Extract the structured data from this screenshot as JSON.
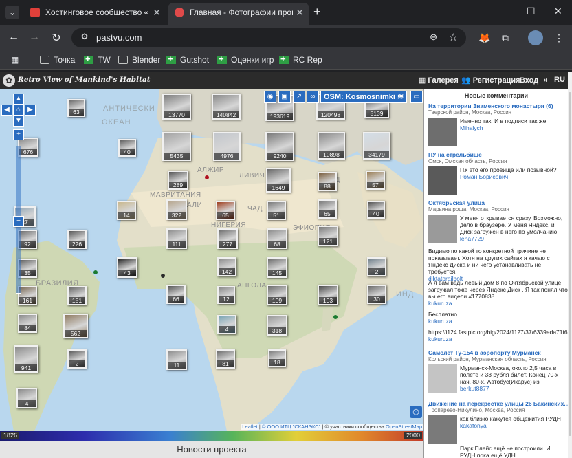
{
  "browser": {
    "tabs": [
      {
        "title": "Хостинговое сообщество «Tim",
        "favicon_color": "#e0403a"
      },
      {
        "title": "Главная - Фотографии прошло",
        "favicon_color": "#e04a4a"
      }
    ],
    "url": "pastvu.com",
    "bookmarks": [
      {
        "label": "Точка",
        "icon": "folder"
      },
      {
        "label": "TW",
        "icon": "green-plus"
      },
      {
        "label": "Blender",
        "icon": "folder"
      },
      {
        "label": "Gutshot",
        "icon": "green-plus"
      },
      {
        "label": "Оценки игр",
        "icon": "green-plus"
      },
      {
        "label": "RC Rep",
        "icon": "green-plus"
      }
    ]
  },
  "site": {
    "title": "Retro View of Mankind's Habitat",
    "nav": {
      "gallery": "Галерея",
      "register": "Регистрация",
      "login": "Вход",
      "lang": "RU"
    }
  },
  "map": {
    "layer_button": "OSM: Kosmosnimki",
    "labels": [
      {
        "id": "ocean",
        "text": "ОКЕАН"
      },
      {
        "id": "atl",
        "text": "АНТИЧЕСКИ"
      },
      {
        "id": "algeria",
        "text": "АЛЖИР"
      },
      {
        "id": "libya",
        "text": "ЛИВИЯ"
      },
      {
        "id": "saudi",
        "text": "САУД"
      },
      {
        "id": "mauritania",
        "text": "МАВРИТАНИЯ"
      },
      {
        "id": "mali",
        "text": "АЛИ"
      },
      {
        "id": "chad",
        "text": "ЧАД"
      },
      {
        "id": "nigeria",
        "text": "НИГЕРИЯ"
      },
      {
        "id": "ethiopia",
        "text": "ЭФИОПИЯ"
      },
      {
        "id": "angola",
        "text": "АНГОЛА"
      },
      {
        "id": "brazil",
        "text": "БРАЗИЛИЯ"
      },
      {
        "id": "indian",
        "text": "ИНД"
      }
    ],
    "clusters": [
      "63",
      "13770",
      "140842",
      "193619",
      "120498",
      "5139",
      "676",
      "40",
      "5435",
      "4976",
      "9240",
      "10898",
      "34179",
      "289",
      "1649",
      "88",
      "57",
      "14",
      "322",
      "65",
      "51",
      "65",
      "40",
      "92",
      "226",
      "111",
      "277",
      "68",
      "121",
      "35",
      "43",
      "142",
      "145",
      "2",
      "161",
      "151",
      "66",
      "12",
      "109",
      "103",
      "30",
      "84",
      "562",
      "4",
      "318",
      "941",
      "2",
      "11",
      "81",
      "18",
      "4",
      "27"
    ],
    "attribution": {
      "leaflet": "Leaflet",
      "itc": "© ООО ИТЦ \"СКАНЭКС\"",
      "community": "| © участники сообщества",
      "osm": "OpenStreetMap"
    },
    "year_start": "1826",
    "year_end": "2000"
  },
  "footer": {
    "news": "Новости проекта"
  },
  "sidebar": {
    "heading": "Новые комментарии",
    "comments": [
      {
        "title": "На территории Знаменского монастыря (6)",
        "region": "Тверской район, Москва, Россия",
        "text": "Именно так. И в подписи так же.",
        "user": "Mihalych"
      },
      {
        "title": "ПУ на стрельбище",
        "region": "Омск, Омская область, Россия",
        "text": "ПУ это его провище или позывной?",
        "user": "Роман Борисович"
      },
      {
        "title": "Октябрьская улица",
        "region": "Марьина роща, Москва, Россия",
        "text": "У меня открывается сразу. Возможно, дело в браузере. У меня Яндекс, и Диск загружен в него по умолчанию.",
        "user": "leha7729"
      },
      {
        "text": "Видимо по какой то конкретной причине не показывает. Хотя на других сайтах я качаю с Яндекс Диска и ни чего устанавливать не требуется.",
        "user": "diktatorailbolt"
      },
      {
        "text": "А я вам ведь левый дом 8 по Октябрьской улице загружал тоже через Яндекс Диск . Я так понял что вы его видели #1770838",
        "user": "kukuruza"
      },
      {
        "text": "Бесплатно",
        "user": "kukuruza"
      },
      {
        "text": "https://i124.fastpic.org/big/2024/1127/37/6339eda71f6e",
        "user": "kukuruza"
      },
      {
        "title": "Самолет Ту-154 в аэропорту Мурманск",
        "region": "Кольский район, Мурманская область, Россия",
        "text": "Мурманск-Москва, около 2,5 часа в полете и 33 рубля билет. Конец 70-х нач. 80-х. Автобус(Икарус) из",
        "user": "berkut8877"
      },
      {
        "title": "Движение на перекрёстке улицы 26 Бакинских...",
        "region": "Тропарёво-Никулино, Москва, Россия",
        "text": "как близко кажутся общежития РУДН",
        "user": "kakafonya"
      },
      {
        "text": "Парк Плейс ещё не построили. И РУДН пока ещё УДН"
      }
    ]
  }
}
